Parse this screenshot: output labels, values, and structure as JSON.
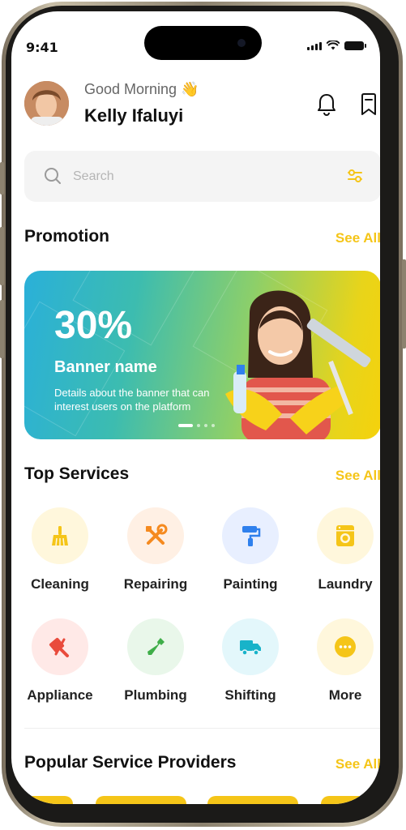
{
  "status_bar": {
    "time": "9:41"
  },
  "header": {
    "greeting": "Good Morning 👋",
    "user_name": "Kelly Ifaluyi"
  },
  "search": {
    "placeholder": "Search"
  },
  "promotion": {
    "title": "Promotion",
    "see_all": "See All",
    "banner": {
      "discount": "30%",
      "name": "Banner name",
      "description": "Details about the banner that can interest users on the platform",
      "slide_count": 4,
      "active_slide": 1
    }
  },
  "top_services": {
    "title": "Top Services",
    "see_all": "See All",
    "items": [
      {
        "label": "Cleaning",
        "icon": "broom-icon",
        "bg": "#fff7dc",
        "fg": "#f5c518"
      },
      {
        "label": "Repairing",
        "icon": "tools-icon",
        "bg": "#fff0e4",
        "fg": "#f58a1f"
      },
      {
        "label": "Painting",
        "icon": "paint-roller-icon",
        "bg": "#e8efff",
        "fg": "#2f80ed"
      },
      {
        "label": "Laundry",
        "icon": "washing-machine-icon",
        "bg": "#fff7dc",
        "fg": "#f5c518"
      },
      {
        "label": "Appliance",
        "icon": "appliance-icon",
        "bg": "#ffe9e7",
        "fg": "#e94b3c"
      },
      {
        "label": "Plumbing",
        "icon": "wrench-icon",
        "bg": "#e9f7ea",
        "fg": "#3fae49"
      },
      {
        "label": "Shifting",
        "icon": "truck-icon",
        "bg": "#e3f7fb",
        "fg": "#18b3c9"
      },
      {
        "label": "More",
        "icon": "more-icon",
        "bg": "#fff7dc",
        "fg": "#f5c518"
      }
    ]
  },
  "popular_providers": {
    "title": "Popular Service Providers",
    "see_all": "See All"
  },
  "colors": {
    "accent": "#f5c518",
    "text_primary": "#111111",
    "text_secondary": "#666666",
    "search_bg": "#f4f4f4"
  }
}
